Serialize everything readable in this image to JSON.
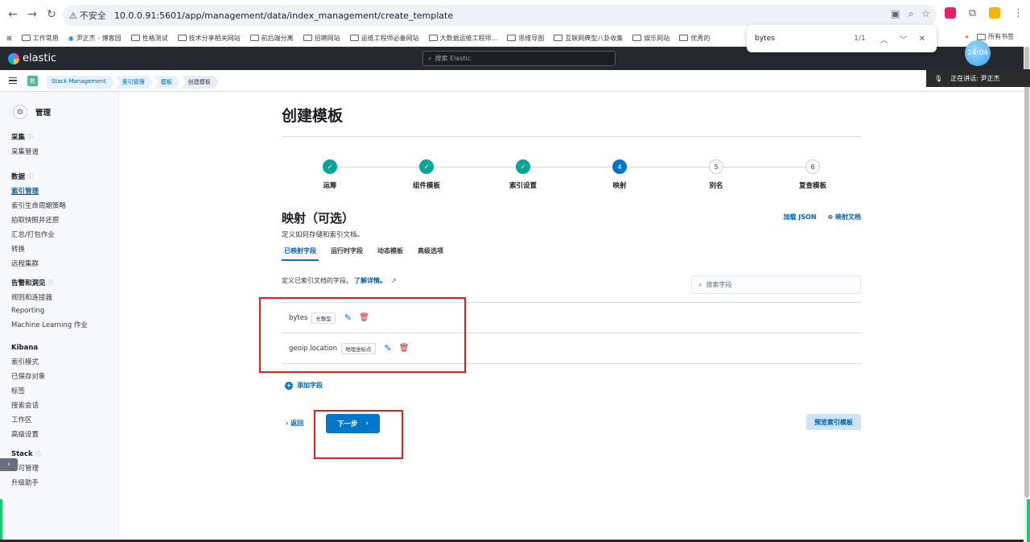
{
  "browser": {
    "security_label": "不安全",
    "url": "10.0.0.91:5601/app/management/data/index_management/create_template",
    "bookmarks": [
      "工作常用",
      "尹正杰 - 博客园",
      "性格测试",
      "技术分享相关网站",
      "前后端分离",
      "招聘网站",
      "运维工程师必备网站",
      "大数据运维工程师...",
      "思维导图",
      "互联网典型八卦收集",
      "娱乐网站",
      "优秀的"
    ],
    "bookmarks_more": "»",
    "all_bookmarks": "所有书签"
  },
  "find_bar": {
    "query": "bytes",
    "count": "1/1"
  },
  "kibana": {
    "brand": "elastic",
    "search_placeholder": "搜索 Elastic",
    "clock": "14:04",
    "space_letter": "默",
    "speaking": "正在讲话: 尹正杰",
    "breadcrumbs": [
      "Stack Management",
      "索引管理",
      "模板",
      "创建模板"
    ]
  },
  "sidenav": {
    "title": "管理",
    "groups": [
      {
        "header": "采集",
        "items": [
          "采集管道"
        ]
      },
      {
        "header": "数据",
        "items": [
          "索引管理",
          "索引生命周期策略",
          "拍取快照并还原",
          "汇总/打包作业",
          "转换",
          "远程集群"
        ]
      },
      {
        "header": "告警和洞见",
        "items": [
          "规则和连接器",
          "Reporting",
          "Machine Learning 作业"
        ]
      },
      {
        "header": "Kibana",
        "items": [
          "索引模式",
          "已保存对象",
          "标签",
          "搜索会话",
          "工作区",
          "高级设置"
        ]
      },
      {
        "header": "Stack",
        "items": [
          "许可管理",
          "升级助手"
        ]
      }
    ],
    "active_item": "索引管理"
  },
  "page": {
    "title": "创建模板",
    "steps": [
      {
        "num": "1",
        "label": "运筹",
        "state": "done"
      },
      {
        "num": "2",
        "label": "组件模板",
        "state": "done"
      },
      {
        "num": "3",
        "label": "索引设置",
        "state": "done"
      },
      {
        "num": "4",
        "label": "映射",
        "state": "current"
      },
      {
        "num": "5",
        "label": "别名",
        "state": "todo"
      },
      {
        "num": "6",
        "label": "复查模板",
        "state": "todo"
      }
    ],
    "section_title": "映射（可选）",
    "section_desc": "定义如何存储和索引文档。",
    "load_json": "加载 JSON",
    "mapping_docs": "映射文档",
    "tabs": [
      "已映射字段",
      "运行时字段",
      "动态模板",
      "高级选项"
    ],
    "tab_desc": "定义已索引文档的字段。",
    "learn_more": "了解详情。",
    "field_search_placeholder": "搜索字段",
    "fields": [
      {
        "name": "bytes",
        "type": "长整型"
      },
      {
        "name": "geoip.location",
        "type": "地理坐标点"
      }
    ],
    "add_field": "添加字段",
    "back": "返回",
    "next": "下一步",
    "preview": "预览索引模板"
  },
  "colors": {
    "primary": "#0077cc",
    "success": "#00a69b",
    "danger": "#bd271e",
    "annotation": "#e0201c",
    "header_bg": "#25282f"
  }
}
